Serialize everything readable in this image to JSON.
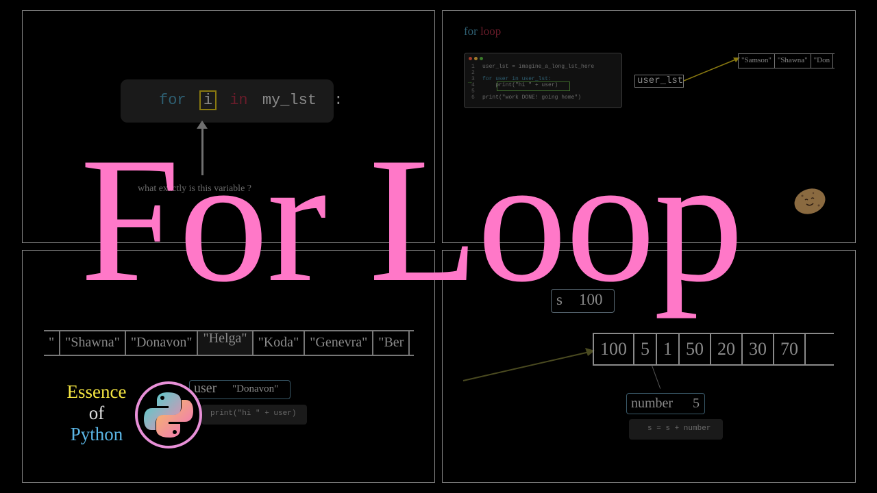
{
  "title": "For Loop",
  "panel1": {
    "code": {
      "for": "for",
      "var": "i",
      "in": "in",
      "iter": "my_lst",
      "colon": ":"
    },
    "question": "what exactly is this variable ?"
  },
  "panel2": {
    "title_for": "for",
    "title_loop": "loop",
    "code_lines": [
      {
        "num": "1",
        "text": "user_lst = imagine_a_long_lst_here"
      },
      {
        "num": "2",
        "text": ""
      },
      {
        "num": "3",
        "text": "for user in user_lst:"
      },
      {
        "num": "4",
        "text": "    print(\"hi \" + user)"
      },
      {
        "num": "5",
        "text": ""
      },
      {
        "num": "6",
        "text": "print(\"work DONE! going home\")"
      }
    ],
    "var_label": "user_lst",
    "list": [
      "\"Samson\"",
      "\"Shawna\"",
      "\"Don"
    ]
  },
  "panel3": {
    "list": [
      "\"",
      "\"Shawna\"",
      "\"Donavon\"",
      "\"Helga\"",
      "\"Koda\"",
      "\"Genevra\"",
      "\"Ber"
    ],
    "user_label": "user",
    "user_value": "\"Donavon\"",
    "print_stmt": "print(\"hi \" + user)"
  },
  "panel4": {
    "s_label": "s",
    "s_value": "100",
    "numbers": [
      "100",
      "5",
      "1",
      "50",
      "20",
      "30",
      "70"
    ],
    "number_label": "number",
    "number_value": "5",
    "expr": "s = s + number"
  },
  "brand": {
    "line1": "Essence",
    "line2": "of",
    "line3": "Python"
  },
  "colors": {
    "title": "#ff78c8",
    "essence": "#f5e642",
    "python": "#5bb6e6"
  }
}
